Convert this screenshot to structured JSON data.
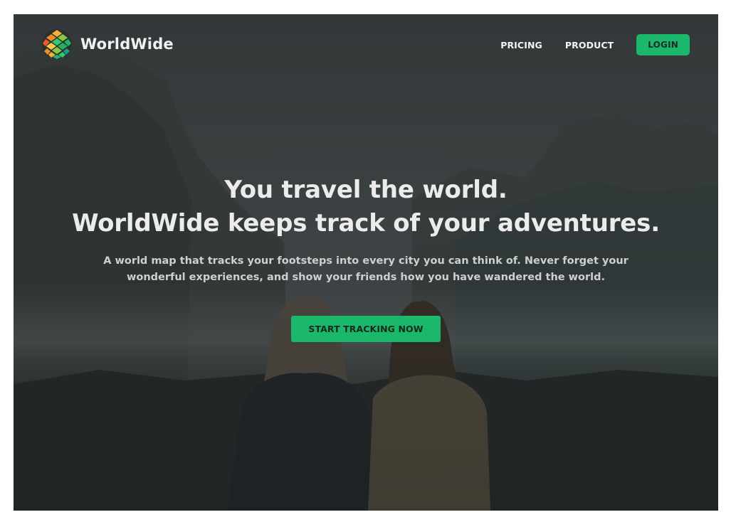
{
  "brand": {
    "name": "WorldWide",
    "logo_icon": "globe-mosaic-icon"
  },
  "nav": {
    "links": [
      {
        "label": "PRICING"
      },
      {
        "label": "PRODUCT"
      }
    ],
    "login_label": "LOGIN"
  },
  "hero": {
    "headline_line1": "You travel the world.",
    "headline_line2": "WorldWide keeps track of your adventures.",
    "subtext": "A world map that tracks your footsteps into every city you can think of. Never forget your wonderful experiences, and show your friends how you have wandered the world.",
    "cta_label": "START TRACKING NOW"
  },
  "colors": {
    "accent": "#1bb76a",
    "background_overlay": "#2b2f30"
  }
}
